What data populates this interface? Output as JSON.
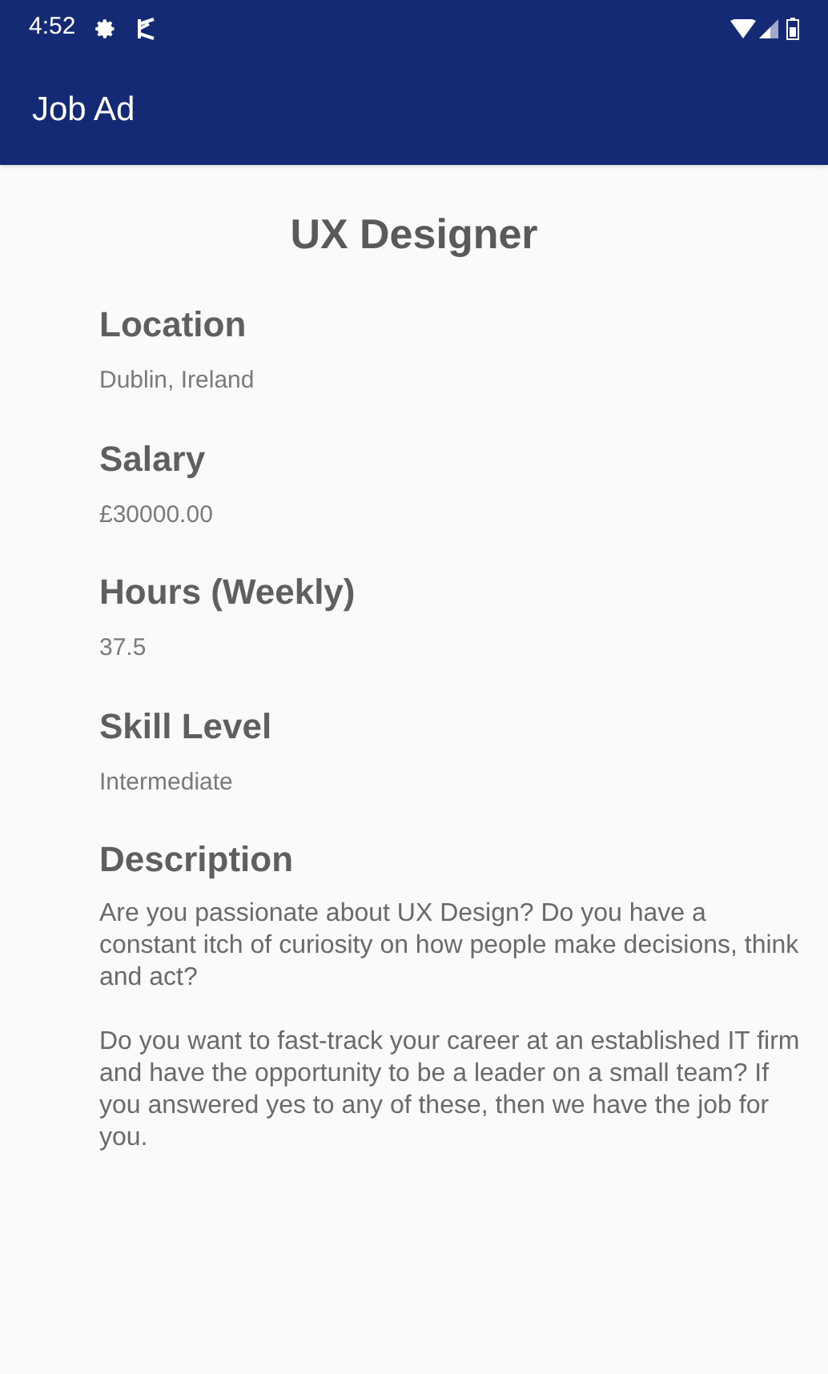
{
  "status_bar": {
    "time": "4:52"
  },
  "app_bar": {
    "title": "Job Ad"
  },
  "job": {
    "title": "UX Designer",
    "fields": [
      {
        "label": "Location",
        "value": "Dublin, Ireland"
      },
      {
        "label": "Salary",
        "value": "£30000.00"
      },
      {
        "label": "Hours (Weekly)",
        "value": "37.5"
      },
      {
        "label": "Skill Level",
        "value": "Intermediate"
      }
    ],
    "description": {
      "label": "Description",
      "paragraphs": [
        "Are you passionate about UX Design? Do you have a constant itch of curiosity on how people make decisions, think and act?",
        "Do you want to fast-track your career at an established IT firm and have the opportunity to be a leader on a small team? If you answered yes to any of these, then we have the job for you."
      ]
    }
  }
}
